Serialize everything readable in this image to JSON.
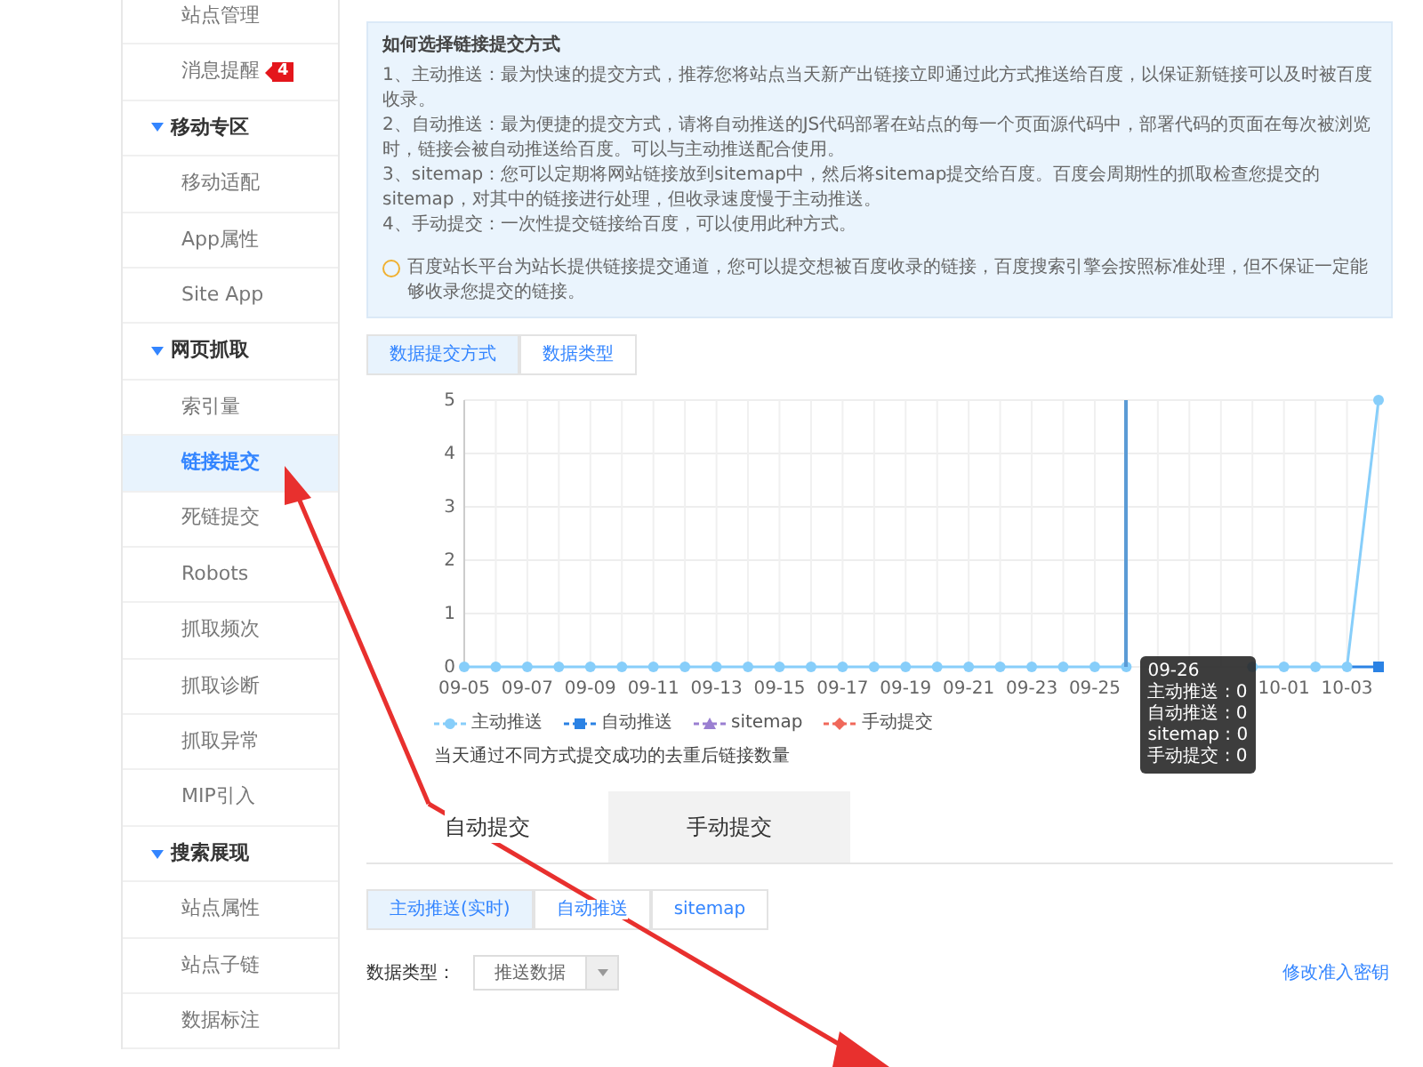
{
  "sidebar": {
    "items": [
      {
        "kind": "item",
        "label": "站点管理",
        "selected": false
      },
      {
        "kind": "item",
        "label": "消息提醒",
        "selected": false,
        "badge": "4"
      },
      {
        "kind": "section",
        "label": "移动专区",
        "expanded": true
      },
      {
        "kind": "item",
        "label": "移动适配",
        "selected": false
      },
      {
        "kind": "item",
        "label": "App属性",
        "selected": false
      },
      {
        "kind": "item",
        "label": "Site App",
        "selected": false
      },
      {
        "kind": "section",
        "label": "网页抓取",
        "expanded": true
      },
      {
        "kind": "item",
        "label": "索引量",
        "selected": false
      },
      {
        "kind": "item",
        "label": "链接提交",
        "selected": true
      },
      {
        "kind": "item",
        "label": "死链提交",
        "selected": false
      },
      {
        "kind": "item",
        "label": "Robots",
        "selected": false
      },
      {
        "kind": "item",
        "label": "抓取频次",
        "selected": false
      },
      {
        "kind": "item",
        "label": "抓取诊断",
        "selected": false
      },
      {
        "kind": "item",
        "label": "抓取异常",
        "selected": false
      },
      {
        "kind": "item",
        "label": "MIP引入",
        "selected": false
      },
      {
        "kind": "section",
        "label": "搜索展现",
        "expanded": true
      },
      {
        "kind": "item",
        "label": "站点属性",
        "selected": false
      },
      {
        "kind": "item",
        "label": "站点子链",
        "selected": false
      },
      {
        "kind": "item",
        "label": "数据标注",
        "selected": false
      }
    ]
  },
  "info_box": {
    "title": "如何选择链接提交方式",
    "lines": [
      "1、主动推送：最为快速的提交方式，推荐您将站点当天新产出链接立即通过此方式推送给百度，以保证新链接可以及时被百度收录。",
      "2、自动推送：最为便捷的提交方式，请将自动推送的JS代码部署在站点的每一个页面源代码中，部署代码的页面在每次被浏览时，链接会被自动推送给百度。可以与主动推送配合使用。",
      "3、sitemap：您可以定期将网站链接放到sitemap中，然后将sitemap提交给百度。百度会周期性的抓取检查您提交的sitemap，对其中的链接进行处理，但收录速度慢于主动推送。",
      "4、手动提交：一次性提交链接给百度，可以使用此种方式。"
    ],
    "notice": "百度站长平台为站长提供链接提交通道，您可以提交想被百度收录的链接，百度搜索引擎会按照标准处理，但不保证一定能够收录您提交的链接。"
  },
  "chart_tabs": [
    {
      "label": "数据提交方式",
      "selected": true
    },
    {
      "label": "数据类型",
      "selected": false
    }
  ],
  "chart": {
    "chart_data": {
      "type": "line",
      "grid": true,
      "categories": [
        "09-05",
        null,
        "09-07",
        null,
        "09-09",
        null,
        "09-11",
        null,
        "09-13",
        null,
        "09-15",
        null,
        "09-17",
        null,
        "09-19",
        null,
        "09-21",
        null,
        "09-23",
        null,
        "09-25",
        null,
        null,
        null,
        null,
        null,
        "10-01",
        null,
        "10-03",
        null
      ],
      "series": [
        {
          "name": "主动推送",
          "color": "#87cefa",
          "marker": "circle",
          "values": [
            0,
            0,
            0,
            0,
            0,
            0,
            0,
            0,
            0,
            0,
            0,
            0,
            0,
            0,
            0,
            0,
            0,
            0,
            0,
            0,
            0,
            0,
            null,
            null,
            null,
            0,
            0,
            0,
            0,
            5
          ]
        },
        {
          "name": "自动推送",
          "color": "#2b82e4",
          "marker": "square",
          "values": [
            null,
            null,
            null,
            null,
            null,
            null,
            null,
            null,
            null,
            null,
            null,
            null,
            null,
            null,
            null,
            null,
            null,
            null,
            null,
            null,
            null,
            null,
            null,
            null,
            null,
            null,
            null,
            null,
            0,
            0
          ]
        },
        {
          "name": "sitemap",
          "color": "#9a7fd1",
          "marker": "triangle",
          "values": [
            null,
            null,
            null,
            null,
            null,
            null,
            null,
            null,
            null,
            null,
            null,
            null,
            null,
            null,
            null,
            null,
            null,
            null,
            null,
            null,
            null,
            null,
            null,
            null,
            null,
            null,
            null,
            null,
            null,
            null
          ]
        },
        {
          "name": "手动提交",
          "color": "#f0685a",
          "marker": "diamond",
          "values": [
            null,
            null,
            null,
            null,
            null,
            null,
            null,
            null,
            null,
            null,
            null,
            null,
            null,
            null,
            null,
            null,
            null,
            null,
            null,
            null,
            null,
            null,
            null,
            null,
            null,
            null,
            null,
            null,
            null,
            null
          ]
        }
      ],
      "ylim": [
        0,
        5
      ],
      "yticks": [
        0,
        1,
        2,
        3,
        4,
        5
      ]
    },
    "tooltip": {
      "title": "09-26",
      "lines": [
        "主动推送 : 0",
        "自动推送 : 0",
        "sitemap : 0",
        "手动提交 : 0"
      ]
    },
    "note": "当天通过不同方式提交成功的去重后链接数量"
  },
  "submit_tabs": [
    {
      "label": "自动提交",
      "selected": true
    },
    {
      "label": "手动提交",
      "selected": false
    }
  ],
  "push_tabs": [
    {
      "label": "主动推送(实时)",
      "selected": true
    },
    {
      "label": "自动推送",
      "selected": false
    },
    {
      "label": "sitemap",
      "selected": false
    }
  ],
  "filter": {
    "label": "数据类型：",
    "value": "推送数据",
    "link": "修改准入密钥"
  }
}
